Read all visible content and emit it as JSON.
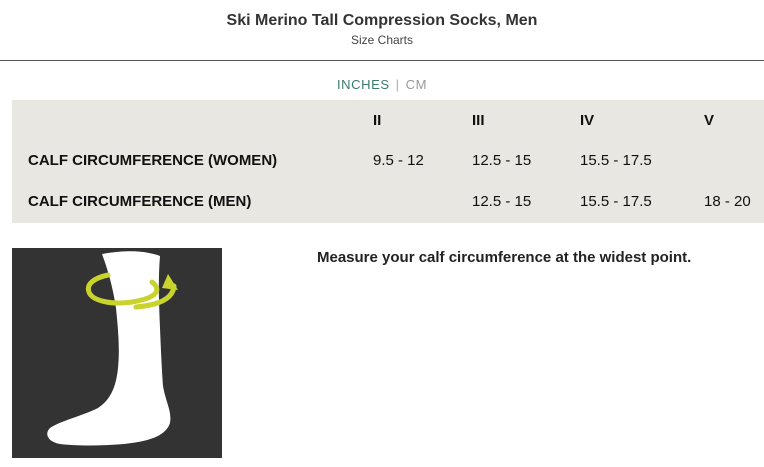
{
  "header": {
    "title": "Ski Merino Tall Compression Socks, Men",
    "subtitle": "Size Charts"
  },
  "units": {
    "inches": "INCHES",
    "separator": "|",
    "cm": "CM",
    "active": "INCHES"
  },
  "size_table": {
    "columns": [
      "",
      "II",
      "III",
      "IV",
      "V"
    ],
    "rows": [
      {
        "label": "CALF CIRCUMFERENCE (WOMEN)",
        "cells": [
          "9.5 - 12",
          "12.5 - 15",
          "15.5 - 17.5",
          ""
        ]
      },
      {
        "label": "CALF CIRCUMFERENCE (MEN)",
        "cells": [
          "",
          "12.5 - 15",
          "15.5 - 17.5",
          "18 - 20"
        ]
      }
    ]
  },
  "instruction": "Measure your calf circumference at the widest point.",
  "colors": {
    "active_unit": "#3d7a6e",
    "table_bg": "#e8e7e1",
    "illustration_bg": "#333333",
    "arrow": "#c8d42b"
  },
  "illustration": {
    "icon": "sock-measure-icon"
  }
}
